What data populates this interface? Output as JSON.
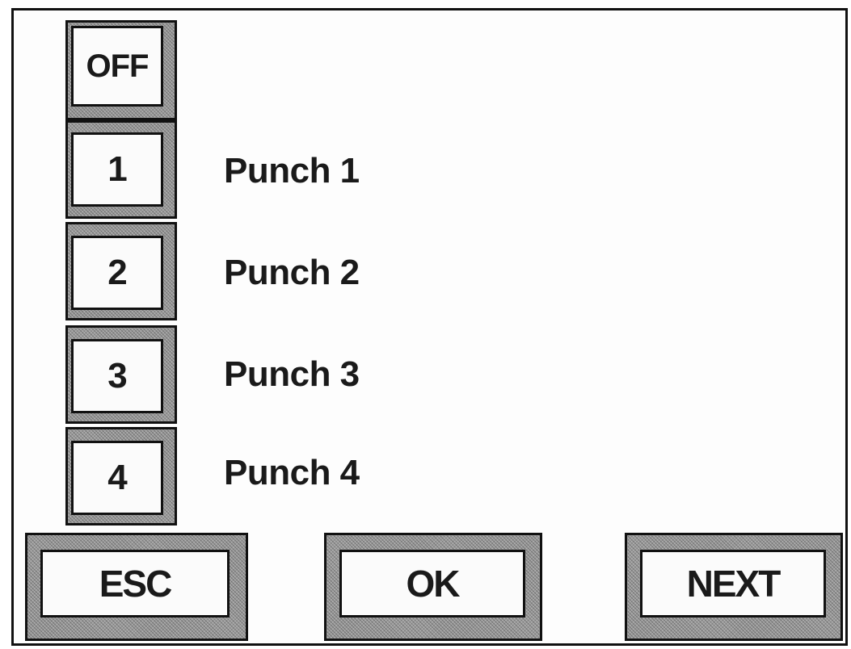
{
  "side_keys": [
    {
      "label": "OFF"
    },
    {
      "label": "1"
    },
    {
      "label": "2"
    },
    {
      "label": "3"
    },
    {
      "label": "4"
    }
  ],
  "rows": [
    {
      "label": "Punch 1"
    },
    {
      "label": "Punch 2"
    },
    {
      "label": "Punch 3"
    },
    {
      "label": "Punch 4"
    }
  ],
  "bottom_buttons": {
    "esc": "ESC",
    "ok": "OK",
    "next": "NEXT"
  }
}
